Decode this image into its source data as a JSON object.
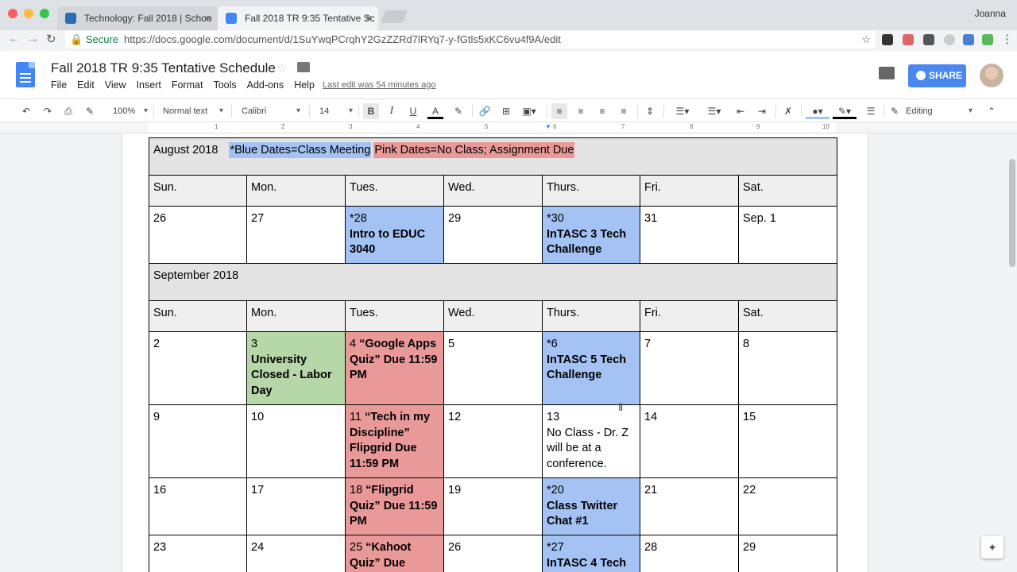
{
  "browser": {
    "tabs": [
      {
        "title": "Technology: Fall 2018 | Schoo",
        "close": "×"
      },
      {
        "title": "Fall 2018 TR 9:35 Tentative Sc",
        "close": "×"
      }
    ],
    "profile_name": "Joanna",
    "secure_label": "Secure",
    "url": "https://docs.google.com/document/d/1SuYwqPCrqhY2GzZZRd7lRYq7-y-fGtls5xKC6vu4f9A/edit",
    "colors": {
      "secure": "#0b8043",
      "tabbar": "#dee1e6"
    }
  },
  "docs": {
    "title": "Fall 2018 TR 9:35 Tentative Schedule",
    "menu": [
      "File",
      "Edit",
      "View",
      "Insert",
      "Format",
      "Tools",
      "Add-ons",
      "Help"
    ],
    "last_edit": "Last edit was 54 minutes ago",
    "share_label": "SHARE",
    "toolbar": {
      "zoom": "100%",
      "style": "Normal text",
      "font": "Calibri",
      "size": "14",
      "mode": "Editing"
    },
    "ruler_numbers": [
      "1",
      "1",
      "2",
      "3",
      "4",
      "5",
      "6",
      "7",
      "8",
      "9",
      "10"
    ],
    "icons": [
      "undo-icon",
      "redo-icon",
      "print-icon",
      "paint-format-icon",
      "bold-icon",
      "italic-icon",
      "underline-icon",
      "text-color-icon",
      "highlight-icon",
      "link-icon",
      "comment-add-icon",
      "image-icon",
      "align-left-icon",
      "align-center-icon",
      "align-right-icon",
      "justify-icon",
      "line-spacing-icon",
      "numbered-list-icon",
      "bulleted-list-icon",
      "indent-decrease-icon",
      "indent-increase-icon",
      "clear-format-icon",
      "fill-color-icon",
      "border-color-icon",
      "border-width-icon",
      "pencil-icon",
      "collapse-icon"
    ]
  },
  "calendar": {
    "colors": {
      "blue": "#a4c2f4",
      "pink": "#ea9999",
      "green": "#b6d7a8",
      "header": "#e4e4e4"
    },
    "legend_blue": "*Blue Dates=Class Meeting",
    "legend_pink": "Pink Dates=No Class; Assignment Due",
    "day_headers": [
      "Sun.",
      "Mon.",
      "Tues.",
      "Wed.",
      "Thurs.",
      "Fri.",
      "Sat."
    ],
    "august": {
      "title": "August 2018",
      "week": [
        {
          "num": "26",
          "text": "",
          "color": ""
        },
        {
          "num": "27",
          "text": "",
          "color": ""
        },
        {
          "num": "*28",
          "text": "Intro to EDUC 3040",
          "color": "blue"
        },
        {
          "num": "29",
          "text": "",
          "color": ""
        },
        {
          "num": "*30",
          "text": "InTASC 3 Tech Challenge",
          "color": "blue"
        },
        {
          "num": "31",
          "text": "",
          "color": ""
        },
        {
          "num": "Sep. 1",
          "text": "",
          "color": ""
        }
      ]
    },
    "september": {
      "title": "September 2018",
      "weeks": [
        [
          {
            "num": "2",
            "text": "",
            "color": ""
          },
          {
            "num": "3",
            "text": "University Closed - Labor Day",
            "color": "green"
          },
          {
            "num": "4",
            "text": "“Google Apps Quiz” Due 11:59 PM",
            "color": "pink"
          },
          {
            "num": "5",
            "text": "",
            "color": ""
          },
          {
            "num": "*6",
            "text": "InTASC 5 Tech Challenge",
            "color": "blue"
          },
          {
            "num": "7",
            "text": "",
            "color": ""
          },
          {
            "num": "8",
            "text": "",
            "color": ""
          }
        ],
        [
          {
            "num": "9",
            "text": "",
            "color": ""
          },
          {
            "num": "10",
            "text": "",
            "color": ""
          },
          {
            "num": "11",
            "text": "“Tech in my Discipline” Flipgrid Due 11:59 PM",
            "color": "pink"
          },
          {
            "num": "12",
            "text": "",
            "color": ""
          },
          {
            "num": "13",
            "text": "No Class - Dr. Z will be at a conference.",
            "color": ""
          },
          {
            "num": "14",
            "text": "",
            "color": ""
          },
          {
            "num": "15",
            "text": "",
            "color": ""
          }
        ],
        [
          {
            "num": "16",
            "text": "",
            "color": ""
          },
          {
            "num": "17",
            "text": "",
            "color": ""
          },
          {
            "num": "18",
            "text": "“Flipgrid Quiz” Due 11:59 PM",
            "color": "pink"
          },
          {
            "num": "19",
            "text": "",
            "color": ""
          },
          {
            "num": "*20",
            "text": "Class Twitter Chat #1",
            "color": "blue"
          },
          {
            "num": "21",
            "text": "",
            "color": ""
          },
          {
            "num": "22",
            "text": "",
            "color": ""
          }
        ],
        [
          {
            "num": "23",
            "text": "",
            "color": ""
          },
          {
            "num": "24",
            "text": "",
            "color": ""
          },
          {
            "num": "25",
            "text": "“Kahoot Quiz” Due",
            "color": "pink"
          },
          {
            "num": "26",
            "text": "",
            "color": ""
          },
          {
            "num": "*27",
            "text": "InTASC 4 Tech",
            "color": "blue"
          },
          {
            "num": "28",
            "text": "",
            "color": ""
          },
          {
            "num": "29",
            "text": "",
            "color": ""
          }
        ]
      ]
    }
  }
}
